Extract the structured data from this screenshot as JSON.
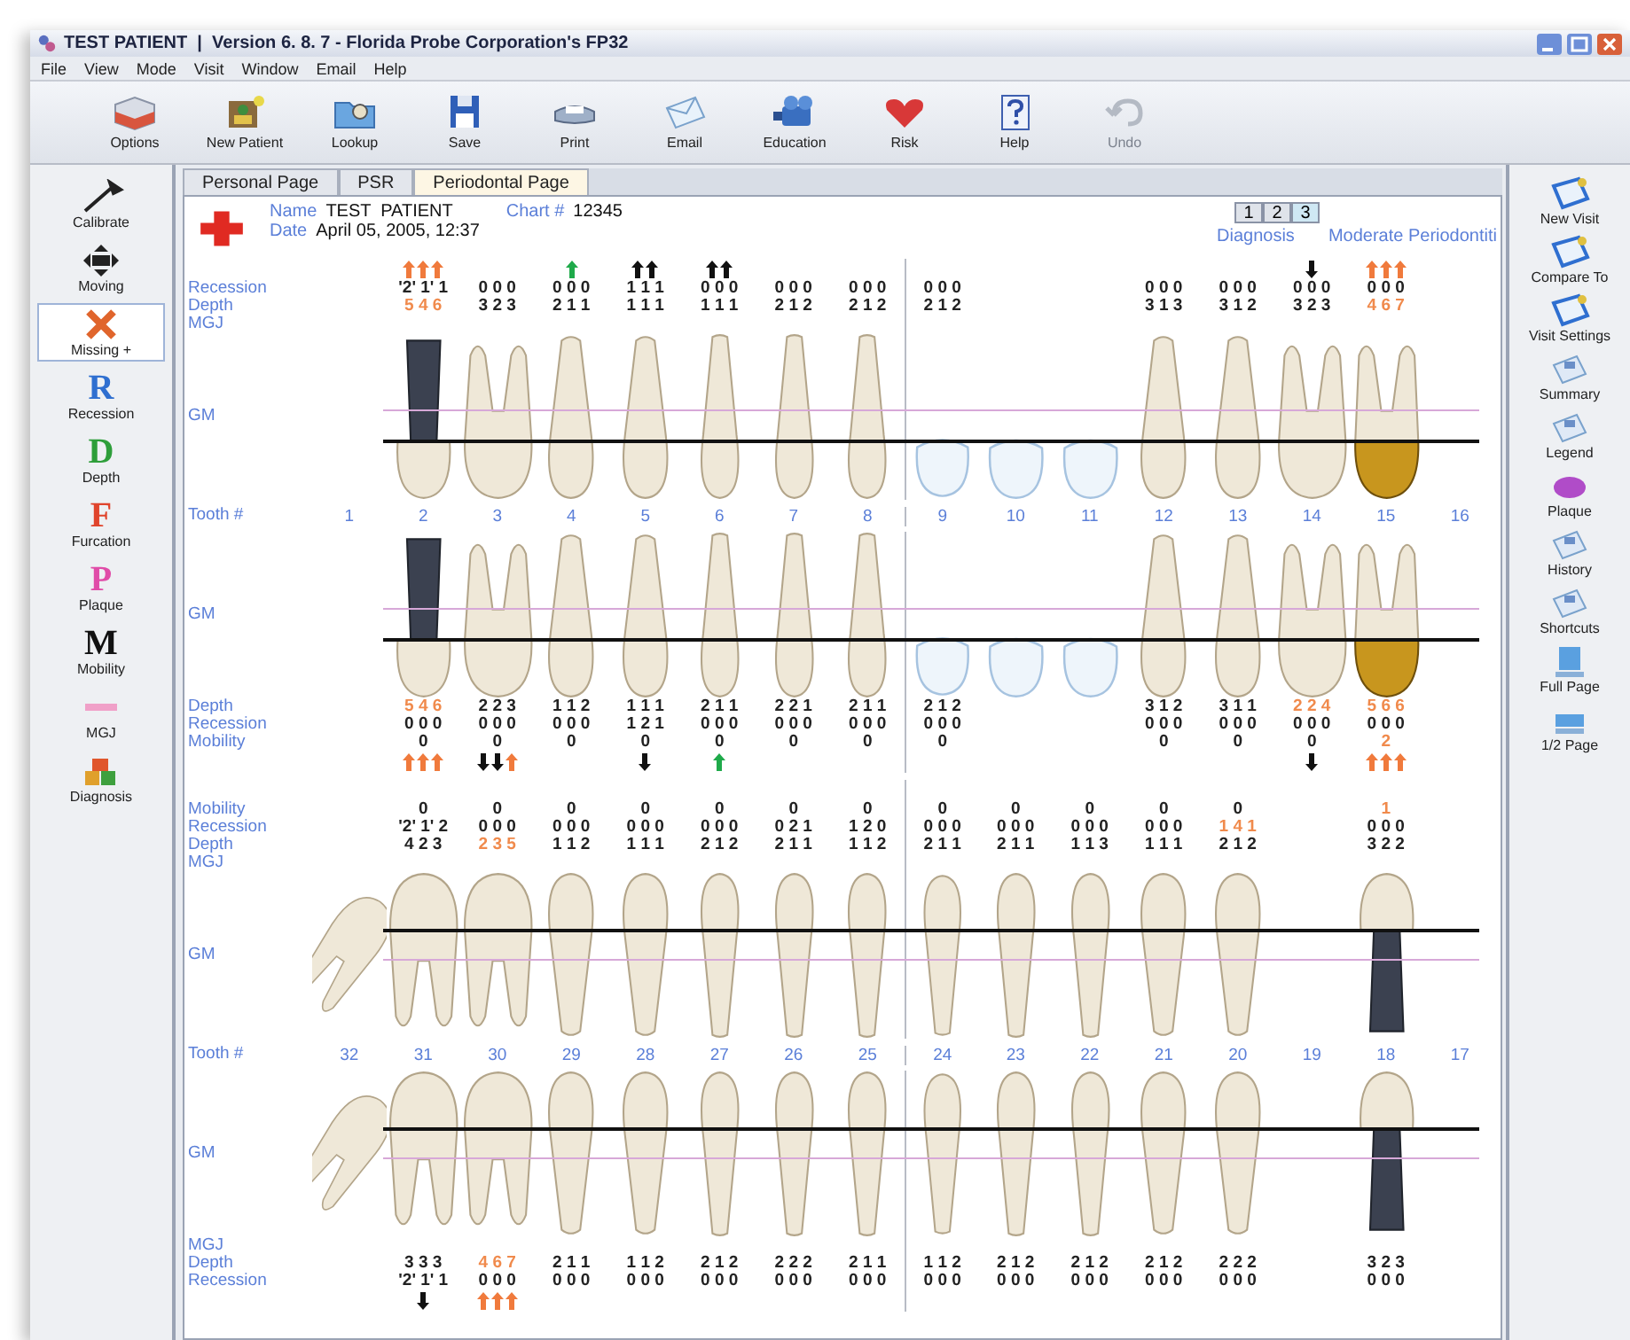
{
  "window": {
    "title": "TEST PATIENT  |  Version 6. 8. 7 - Florida Probe Corporation's FP32"
  },
  "menu": [
    "File",
    "View",
    "Mode",
    "Visit",
    "Window",
    "Email",
    "Help"
  ],
  "toolbar": [
    {
      "label": "Options",
      "disabled": false
    },
    {
      "label": "New Patient",
      "disabled": false
    },
    {
      "label": "Lookup",
      "disabled": false
    },
    {
      "label": "Save",
      "disabled": false
    },
    {
      "label": "Print",
      "disabled": false
    },
    {
      "label": "Email",
      "disabled": false
    },
    {
      "label": "Education",
      "disabled": false
    },
    {
      "label": "Risk",
      "disabled": false
    },
    {
      "label": "Help",
      "disabled": false
    },
    {
      "label": "Undo",
      "disabled": true
    }
  ],
  "left_tools": [
    {
      "label": "Calibrate",
      "selected": false
    },
    {
      "label": "Moving",
      "selected": false
    },
    {
      "label": "Missing +",
      "selected": true
    },
    {
      "label": "Recession",
      "glyph": "R",
      "color": "#2f6fd0",
      "selected": false
    },
    {
      "label": "Depth",
      "glyph": "D",
      "color": "#2e9e3a",
      "selected": false
    },
    {
      "label": "Furcation",
      "glyph": "F",
      "color": "#e0442c",
      "selected": false
    },
    {
      "label": "Plaque",
      "glyph": "P",
      "color": "#e04ca8",
      "selected": false
    },
    {
      "label": "Mobility",
      "glyph": "M",
      "color": "#111111",
      "selected": false
    },
    {
      "label": "MGJ",
      "selected": false
    },
    {
      "label": "Diagnosis",
      "selected": false
    }
  ],
  "right_tools": [
    "New Visit",
    "Compare To",
    "Visit Settings",
    "Summary",
    "Legend",
    "Plaque",
    "History",
    "Shortcuts",
    "Full Page",
    "1/2 Page"
  ],
  "tabs": [
    {
      "label": "Personal Page",
      "selected": false
    },
    {
      "label": "PSR",
      "selected": false
    },
    {
      "label": "Periodontal Page",
      "selected": true
    }
  ],
  "patient": {
    "name_label": "Name",
    "name": "TEST  PATIENT",
    "date_label": "Date",
    "date": "April 05, 2005, 12:37",
    "chart_label": "Chart #",
    "chart": "12345"
  },
  "pages": [
    {
      "label": "1",
      "selected": false
    },
    {
      "label": "2",
      "selected": false
    },
    {
      "label": "3",
      "selected": true
    }
  ],
  "diagnosis": {
    "label": "Diagnosis",
    "value": "Moderate Periodontiti"
  },
  "sections": [
    {
      "kind": "upper_chart",
      "gm_label": "GM",
      "rows_top": [
        {
          "label": "Recession",
          "kind": "recession"
        },
        {
          "label": "Depth",
          "kind": "depth"
        },
        {
          "label": "MGJ",
          "kind": "mgj"
        }
      ],
      "teeth": [
        {
          "kind": "missing"
        },
        {
          "kind": "implant",
          "markers_top": [
            {
              "kind": "up",
              "color": "#f07a3c"
            },
            {
              "kind": "up",
              "color": "#f07a3c"
            },
            {
              "kind": "up",
              "color": "#f07a3c"
            }
          ],
          "recession": {
            "text": "'2' 1' 1",
            "alert": false
          },
          "depth": {
            "text": "5 4 6",
            "alert": true
          }
        },
        {
          "kind": "molar",
          "recession": {
            "text": "0 0 0",
            "alert": false
          },
          "depth": {
            "text": "3 2 3",
            "alert": false
          }
        },
        {
          "kind": "premolar",
          "markers_top": [
            {
              "kind": "up",
              "color": "#1faa4a"
            }
          ],
          "recession": {
            "text": "0 0 0",
            "alert": false
          },
          "depth": {
            "text": "2 1 1",
            "alert": false
          }
        },
        {
          "kind": "premolar",
          "markers_top": [
            {
              "kind": "up",
              "color": "#111111"
            },
            {
              "kind": "up",
              "color": "#111111"
            }
          ],
          "recession": {
            "text": "1 1 1",
            "alert": false
          },
          "depth": {
            "text": "1 1 1",
            "alert": false
          }
        },
        {
          "kind": "anterior",
          "markers_top": [
            {
              "kind": "up",
              "color": "#111111"
            },
            {
              "kind": "up",
              "color": "#111111"
            }
          ],
          "recession": {
            "text": "0 0 0",
            "alert": false
          },
          "depth": {
            "text": "1 1 1",
            "alert": false
          }
        },
        {
          "kind": "anterior",
          "recession": {
            "text": "0 0 0",
            "alert": false
          },
          "depth": {
            "text": "2 1 2",
            "alert": false
          }
        },
        {
          "kind": "anterior",
          "recession": {
            "text": "0 0 0",
            "alert": false
          },
          "depth": {
            "text": "2 1 2",
            "alert": false
          }
        },
        {
          "kind": "ghost",
          "recession": {
            "text": "0 0 0",
            "alert": false
          },
          "depth": {
            "text": "2 1 2",
            "alert": false
          }
        },
        {
          "kind": "ghost"
        },
        {
          "kind": "ghost"
        },
        {
          "kind": "premolar",
          "recession": {
            "text": "0 0 0",
            "alert": false
          },
          "depth": {
            "text": "3 1 3",
            "alert": false
          }
        },
        {
          "kind": "premolar",
          "recession": {
            "text": "0 0 0",
            "alert": false
          },
          "depth": {
            "text": "3 1 2",
            "alert": false
          }
        },
        {
          "kind": "molar",
          "markers_top": [
            {
              "kind": "down",
              "color": "#111111"
            }
          ],
          "recession": {
            "text": "0 0 0",
            "alert": false
          },
          "depth": {
            "text": "3 2 3",
            "alert": false
          }
        },
        {
          "kind": "crown",
          "markers_top": [
            {
              "kind": "up",
              "color": "#f07a3c"
            },
            {
              "kind": "up",
              "color": "#f07a3c"
            },
            {
              "kind": "up",
              "color": "#f07a3c"
            }
          ],
          "recession": {
            "text": "0 0 0",
            "alert": false
          },
          "depth": {
            "text": "4 6 7",
            "alert": true
          }
        },
        {
          "kind": "missing"
        }
      ]
    },
    {
      "kind": "numbers",
      "label": "Tooth #",
      "values": [
        "1",
        "2",
        "3",
        "4",
        "5",
        "6",
        "7",
        "8",
        "9",
        "10",
        "11",
        "12",
        "13",
        "14",
        "15",
        "16"
      ]
    },
    {
      "kind": "upper_chart",
      "gm_label": "GM",
      "rows_bottom": [
        {
          "label": "Depth",
          "kind": "depth"
        },
        {
          "label": "Recession",
          "kind": "recession"
        },
        {
          "label": "Mobility",
          "kind": "mobility"
        }
      ],
      "teeth": [
        {
          "kind": "missing"
        },
        {
          "kind": "implant",
          "depth": {
            "text": "5 4 6",
            "alert": true
          },
          "recession": {
            "text": "0 0 0",
            "alert": false
          },
          "mobility": {
            "text": "0",
            "alert": false
          },
          "markers_bottom": [
            {
              "kind": "up",
              "color": "#f07a3c"
            },
            {
              "kind": "up",
              "color": "#f07a3c"
            },
            {
              "kind": "up",
              "color": "#f07a3c"
            }
          ]
        },
        {
          "kind": "molar",
          "depth": {
            "text": "2 2 3",
            "alert": false
          },
          "recession": {
            "text": "0 0 0",
            "alert": false
          },
          "mobility": {
            "text": "0",
            "alert": false
          },
          "markers_bottom": [
            {
              "kind": "down",
              "color": "#111111"
            },
            {
              "kind": "down",
              "color": "#111111"
            },
            {
              "kind": "up",
              "color": "#f07a3c"
            }
          ]
        },
        {
          "kind": "premolar",
          "depth": {
            "text": "1 1 2",
            "alert": false
          },
          "recession": {
            "text": "0 0 0",
            "alert": false
          },
          "mobility": {
            "text": "0",
            "alert": false
          }
        },
        {
          "kind": "premolar",
          "depth": {
            "text": "1 1 1",
            "alert": false
          },
          "recession": {
            "text": "1 2 1",
            "alert": false
          },
          "mobility": {
            "text": "0",
            "alert": false
          },
          "markers_bottom": [
            {
              "kind": "down",
              "color": "#111111"
            }
          ]
        },
        {
          "kind": "anterior",
          "depth": {
            "text": "2 1 1",
            "alert": false
          },
          "recession": {
            "text": "0 0 0",
            "alert": false
          },
          "mobility": {
            "text": "0",
            "alert": false
          },
          "markers_bottom": [
            {
              "kind": "up",
              "color": "#1faa4a"
            }
          ]
        },
        {
          "kind": "anterior",
          "depth": {
            "text": "2 2 1",
            "alert": false
          },
          "recession": {
            "text": "0 0 0",
            "alert": false
          },
          "mobility": {
            "text": "0",
            "alert": false
          }
        },
        {
          "kind": "anterior",
          "depth": {
            "text": "2 1 1",
            "alert": false
          },
          "recession": {
            "text": "0 0 0",
            "alert": false
          },
          "mobility": {
            "text": "0",
            "alert": false
          }
        },
        {
          "kind": "ghost",
          "depth": {
            "text": "2 1 2",
            "alert": false
          },
          "recession": {
            "text": "0 0 0",
            "alert": false
          },
          "mobility": {
            "text": "0",
            "alert": false
          }
        },
        {
          "kind": "ghost"
        },
        {
          "kind": "ghost"
        },
        {
          "kind": "premolar",
          "depth": {
            "text": "3 1 2",
            "alert": false
          },
          "recession": {
            "text": "0 0 0",
            "alert": false
          },
          "mobility": {
            "text": "0",
            "alert": false
          }
        },
        {
          "kind": "premolar",
          "depth": {
            "text": "3 1 1",
            "alert": false
          },
          "recession": {
            "text": "0 0 0",
            "alert": false
          },
          "mobility": {
            "text": "0",
            "alert": false
          }
        },
        {
          "kind": "molar",
          "depth": {
            "text": "2 2 4",
            "alert": true
          },
          "recession": {
            "text": "0 0 0",
            "alert": false
          },
          "mobility": {
            "text": "0",
            "alert": false
          },
          "markers_bottom": [
            {
              "kind": "down",
              "color": "#111111"
            }
          ]
        },
        {
          "kind": "crown",
          "depth": {
            "text": "5 6 6",
            "alert": true
          },
          "recession": {
            "text": "0 0 0",
            "alert": false
          },
          "mobility": {
            "text": "2",
            "alert": true
          },
          "markers_bottom": [
            {
              "kind": "up",
              "color": "#f07a3c"
            },
            {
              "kind": "up",
              "color": "#f07a3c"
            },
            {
              "kind": "up",
              "color": "#f07a3c"
            }
          ]
        },
        {
          "kind": "missing"
        }
      ]
    },
    {
      "kind": "lower_chart",
      "gm_label": "GM",
      "rows_top": [
        {
          "label": "Mobility",
          "kind": "mobility"
        },
        {
          "label": "Recession",
          "kind": "recession"
        },
        {
          "label": "Depth",
          "kind": "depth"
        },
        {
          "label": "MGJ",
          "kind": "mgj"
        }
      ],
      "teeth": [
        {
          "kind": "tilted"
        },
        {
          "kind": "molar",
          "mobility": {
            "text": "0",
            "alert": false
          },
          "recession": {
            "text": "'2' 1' 2",
            "alert": false
          },
          "depth": {
            "text": "4 2 3",
            "alert": false
          }
        },
        {
          "kind": "molar",
          "mobility": {
            "text": "0",
            "alert": false
          },
          "recession": {
            "text": "0 0 0",
            "alert": false
          },
          "depth": {
            "text": "2 3 5",
            "alert": true
          }
        },
        {
          "kind": "premolar",
          "mobility": {
            "text": "0",
            "alert": false
          },
          "recession": {
            "text": "0 0 0",
            "alert": false
          },
          "depth": {
            "text": "1 1 2",
            "alert": false
          }
        },
        {
          "kind": "premolar",
          "mobility": {
            "text": "0",
            "alert": false
          },
          "recession": {
            "text": "0 0 0",
            "alert": false
          },
          "depth": {
            "text": "1 1 1",
            "alert": false
          }
        },
        {
          "kind": "anterior",
          "mobility": {
            "text": "0",
            "alert": false
          },
          "recession": {
            "text": "0 0 0",
            "alert": false
          },
          "depth": {
            "text": "2 1 2",
            "alert": false
          }
        },
        {
          "kind": "anterior",
          "mobility": {
            "text": "0",
            "alert": false
          },
          "recession": {
            "text": "0 2 1",
            "alert": false
          },
          "depth": {
            "text": "2 1 1",
            "alert": false
          }
        },
        {
          "kind": "anterior",
          "mobility": {
            "text": "0",
            "alert": false
          },
          "recession": {
            "text": "1 2 0",
            "alert": false
          },
          "depth": {
            "text": "1 1 2",
            "alert": false
          }
        },
        {
          "kind": "anterior",
          "mobility": {
            "text": "0",
            "alert": false
          },
          "recession": {
            "text": "0 0 0",
            "alert": false
          },
          "depth": {
            "text": "2 1 1",
            "alert": false
          }
        },
        {
          "kind": "anterior",
          "mobility": {
            "text": "0",
            "alert": false
          },
          "recession": {
            "text": "0 0 0",
            "alert": false
          },
          "depth": {
            "text": "2 1 1",
            "alert": false
          }
        },
        {
          "kind": "anterior",
          "mobility": {
            "text": "0",
            "alert": false
          },
          "recession": {
            "text": "0 0 0",
            "alert": false
          },
          "depth": {
            "text": "1 1 3",
            "alert": false
          }
        },
        {
          "kind": "premolar",
          "mobility": {
            "text": "0",
            "alert": false
          },
          "recession": {
            "text": "0 0 0",
            "alert": false
          },
          "depth": {
            "text": "1 1 1",
            "alert": false
          }
        },
        {
          "kind": "premolar",
          "mobility": {
            "text": "0",
            "alert": false
          },
          "recession": {
            "text": "1 4 1",
            "alert": true
          },
          "depth": {
            "text": "2 1 2",
            "alert": false
          }
        },
        {
          "kind": "missing"
        },
        {
          "kind": "implant",
          "mobility": {
            "text": "1",
            "alert": true
          },
          "recession": {
            "text": "0 0 0",
            "alert": false
          },
          "depth": {
            "text": "3 2 2",
            "alert": false
          }
        },
        {
          "kind": "missing"
        }
      ]
    },
    {
      "kind": "numbers",
      "label": "Tooth #",
      "values": [
        "32",
        "31",
        "30",
        "29",
        "28",
        "27",
        "26",
        "25",
        "24",
        "23",
        "22",
        "21",
        "20",
        "19",
        "18",
        "17"
      ]
    },
    {
      "kind": "lower_chart",
      "gm_label": "GM",
      "rows_bottom": [
        {
          "label": "MGJ",
          "kind": "mgj"
        },
        {
          "label": "Depth",
          "kind": "depth"
        },
        {
          "label": "Recession",
          "kind": "recession"
        }
      ],
      "teeth": [
        {
          "kind": "tilted"
        },
        {
          "kind": "molar",
          "depth": {
            "text": "3 3 3",
            "alert": false
          },
          "recession": {
            "text": "'2' 1' 1",
            "alert": false
          },
          "markers_bottom": [
            {
              "kind": "down",
              "color": "#111111"
            }
          ]
        },
        {
          "kind": "molar",
          "depth": {
            "text": "4 6 7",
            "alert": true
          },
          "recession": {
            "text": "0 0 0",
            "alert": false
          },
          "markers_bottom": [
            {
              "kind": "up",
              "color": "#f07a3c"
            },
            {
              "kind": "up",
              "color": "#f07a3c"
            },
            {
              "kind": "up",
              "color": "#f07a3c"
            }
          ]
        },
        {
          "kind": "premolar",
          "depth": {
            "text": "2 1 1",
            "alert": false
          },
          "recession": {
            "text": "0 0 0",
            "alert": false
          }
        },
        {
          "kind": "premolar",
          "depth": {
            "text": "1 1 2",
            "alert": false
          },
          "recession": {
            "text": "0 0 0",
            "alert": false
          }
        },
        {
          "kind": "anterior",
          "depth": {
            "text": "2 1 2",
            "alert": false
          },
          "recession": {
            "text": "0 0 0",
            "alert": false
          }
        },
        {
          "kind": "anterior",
          "depth": {
            "text": "2 2 2",
            "alert": false
          },
          "recession": {
            "text": "0 0 0",
            "alert": false
          }
        },
        {
          "kind": "anterior",
          "depth": {
            "text": "2 1 1",
            "alert": false
          },
          "recession": {
            "text": "0 0 0",
            "alert": false
          }
        },
        {
          "kind": "anterior",
          "depth": {
            "text": "1 1 2",
            "alert": false
          },
          "recession": {
            "text": "0 0 0",
            "alert": false
          }
        },
        {
          "kind": "anterior",
          "depth": {
            "text": "2 1 2",
            "alert": false
          },
          "recession": {
            "text": "0 0 0",
            "alert": false
          }
        },
        {
          "kind": "anterior",
          "depth": {
            "text": "2 1 2",
            "alert": false
          },
          "recession": {
            "text": "0 0 0",
            "alert": false
          }
        },
        {
          "kind": "premolar",
          "depth": {
            "text": "2 1 2",
            "alert": false
          },
          "recession": {
            "text": "0 0 0",
            "alert": false
          }
        },
        {
          "kind": "premolar",
          "depth": {
            "text": "2 2 2",
            "alert": false
          },
          "recession": {
            "text": "0 0 0",
            "alert": false
          }
        },
        {
          "kind": "missing"
        },
        {
          "kind": "implant",
          "depth": {
            "text": "3 2 3",
            "alert": false
          },
          "recession": {
            "text": "0 0 0",
            "alert": false
          }
        },
        {
          "kind": "missing"
        }
      ]
    }
  ]
}
